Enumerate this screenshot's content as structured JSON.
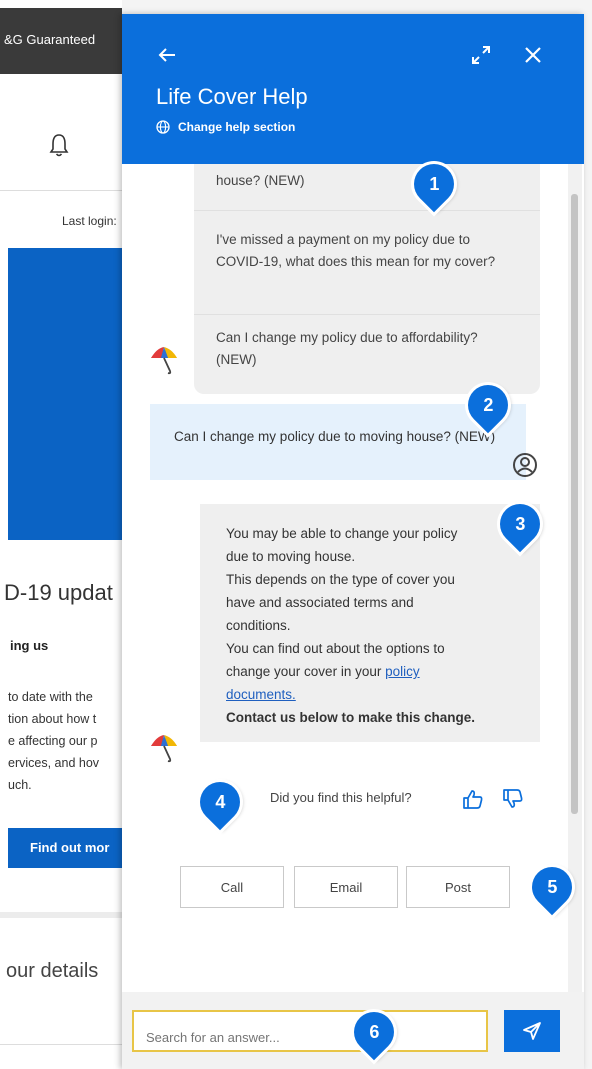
{
  "background_page": {
    "topbar_text": "&G Guaranteed",
    "last_login": "Last login:",
    "covid_heading": "D-19 updat",
    "contacting": "ing us",
    "paragraph": [
      "to date with the",
      "tion about how t",
      "e affecting our p",
      "ervices, and hov",
      "uch."
    ],
    "find_out_button": "Find out mor",
    "your_details": "our details"
  },
  "panel": {
    "title": "Life Cover Help",
    "change_section": "Change help section",
    "options": [
      "house? (NEW)",
      "I've missed a payment on my policy due to COVID-19, what does this mean for my cover?",
      "Can I change my policy due to affordability? (NEW)"
    ],
    "user_message": "Can I change my policy due to moving house? (NEW)",
    "bot_response": {
      "lines_before_link": [
        "You may be able to change your policy",
        "due to moving house.",
        "This depends on the type of cover you",
        "have and associated terms and",
        "conditions.",
        "You can find out about the options to",
        "change your cover in your "
      ],
      "link_line1": "policy",
      "link_line2": "documents.",
      "bold_line": "Contact us below to make this change."
    },
    "feedback_prompt": "Did you find this helpful?",
    "contact_buttons": {
      "call": "Call",
      "email": "Email",
      "post": "Post"
    },
    "search_placeholder": "Search for an answer..."
  },
  "markers": [
    "1",
    "2",
    "3",
    "4",
    "5",
    "6"
  ],
  "colors": {
    "brand_blue": "#0b6fdc",
    "search_border": "#e8c547",
    "user_bubble": "#e5f1fc",
    "bot_bubble": "#efefef"
  },
  "icons": [
    "back-arrow-icon",
    "expand-icon",
    "close-icon",
    "globe-icon",
    "umbrella-icon",
    "user-icon",
    "thumbs-up-icon",
    "thumbs-down-icon",
    "send-icon",
    "bell-icon"
  ]
}
